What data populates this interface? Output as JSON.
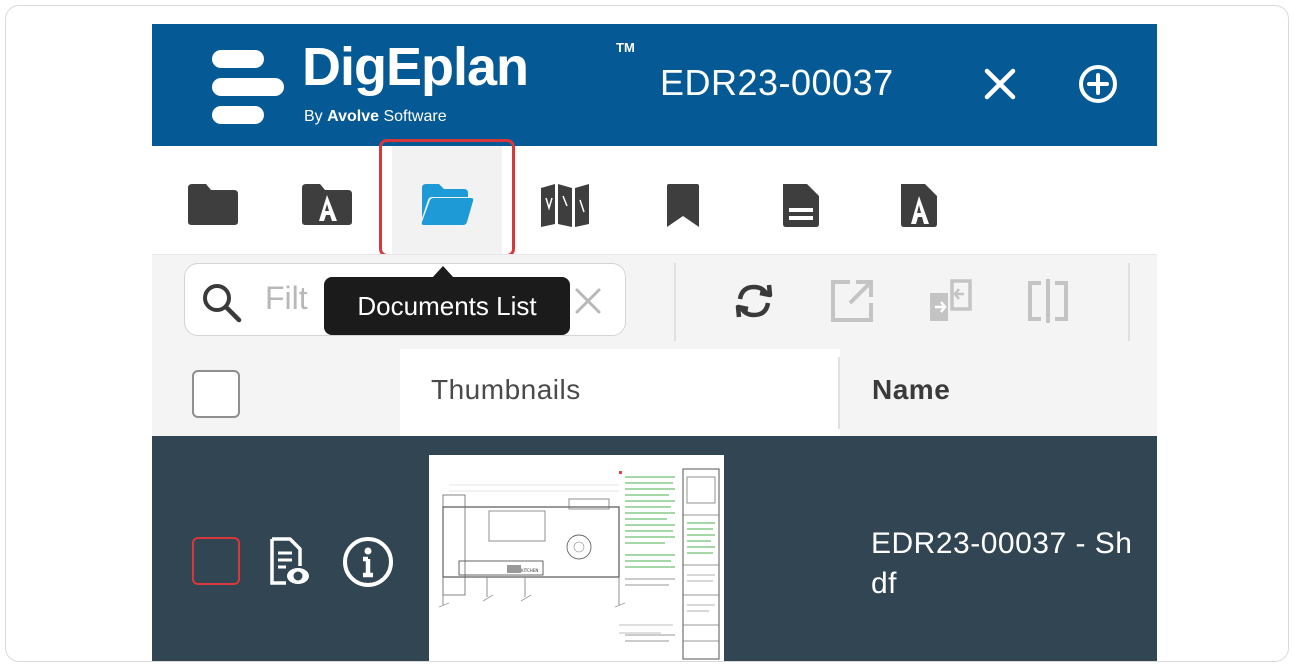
{
  "header": {
    "logo_word": "DigEplan",
    "logo_tm": "TM",
    "logo_by": "By",
    "logo_company": "Avolve",
    "logo_company_suffix": "Software",
    "project_id": "EDR23-00037",
    "close_icon": "close-icon",
    "add_icon": "add-circle-icon",
    "background_color": "#055a96"
  },
  "tabs": [
    {
      "icon": "folder-icon",
      "active": false
    },
    {
      "icon": "folder-a-icon",
      "active": false
    },
    {
      "icon": "open-folder-icon",
      "active": true
    },
    {
      "icon": "map-icon",
      "active": false
    },
    {
      "icon": "bookmark-icon",
      "active": false
    },
    {
      "icon": "document-icon",
      "active": false
    },
    {
      "icon": "document-a-icon",
      "active": false
    }
  ],
  "tooltip": {
    "text": "Documents List"
  },
  "toolbar": {
    "search_placeholder": "Filt",
    "search_icon": "search-icon",
    "clear_icon": "clear-icon",
    "buttons": [
      "refresh-icon",
      "open-external-icon",
      "compare-icon",
      "split-view-icon"
    ]
  },
  "table": {
    "columns": {
      "thumbnails": "Thumbnails",
      "name": "Name"
    },
    "rows": [
      {
        "name_line1": "EDR23-00037 - Sh",
        "name_line2": "df",
        "icons": [
          "document-preview-icon",
          "info-icon"
        ],
        "checked": false
      }
    ]
  },
  "colors": {
    "accent": "#1e9ad6",
    "highlight": "#d9383b",
    "row_bg": "#324553"
  }
}
